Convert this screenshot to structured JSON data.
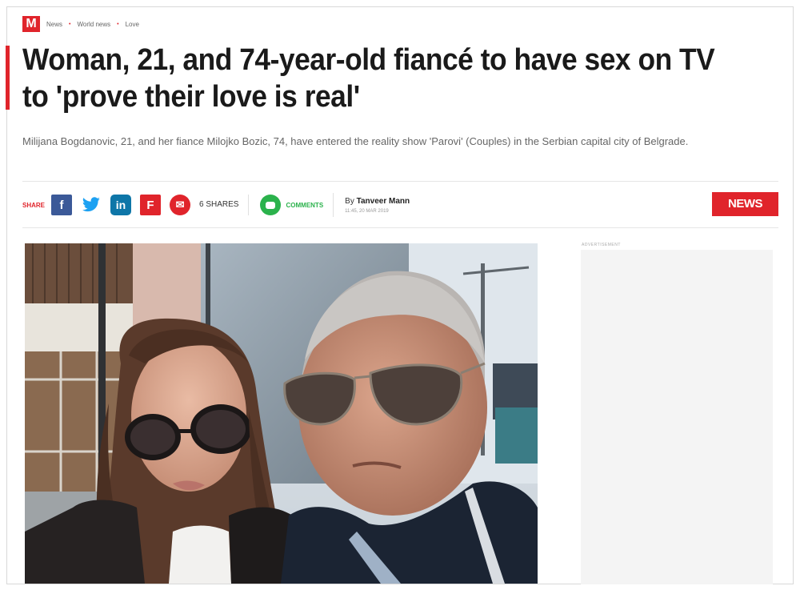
{
  "breadcrumb": {
    "logo": "M",
    "items": [
      "News",
      "World news",
      "Love"
    ],
    "separators": [
      "•",
      "•"
    ]
  },
  "article": {
    "headline": "Woman, 21, and 74-year-old fiancé to have sex on TV to 'prove their love is real'",
    "standfirst": "Milijana Bogdanovic, 21, and her fiance Milojko Bozic, 74, have entered the reality show 'Parovi' (Couples) in the Serbian capital city of Belgrade."
  },
  "share_bar": {
    "label": "SHARE",
    "buttons": [
      {
        "icon": "facebook-icon",
        "glyph": "f"
      },
      {
        "icon": "twitter-icon",
        "glyph": "🐦"
      },
      {
        "icon": "linkedin-icon",
        "glyph": "in"
      },
      {
        "icon": "flipboard-icon",
        "glyph": "F"
      },
      {
        "icon": "email-icon",
        "glyph": "✉"
      }
    ],
    "shares_count": "6 SHARES",
    "comments_label": "COMMENTS",
    "byline_prefix": "By",
    "author": "Tanveer Mann",
    "date": "11:45, 20 MAR 2019",
    "section_button": "NEWS"
  },
  "advert": {
    "label": "ADVERTISEMENT"
  },
  "colors": {
    "brand_red": "#e0242b",
    "facebook": "#3b5998",
    "twitter": "#1da1f2",
    "linkedin": "#0e76a8",
    "comments_green": "#2bb24c"
  }
}
